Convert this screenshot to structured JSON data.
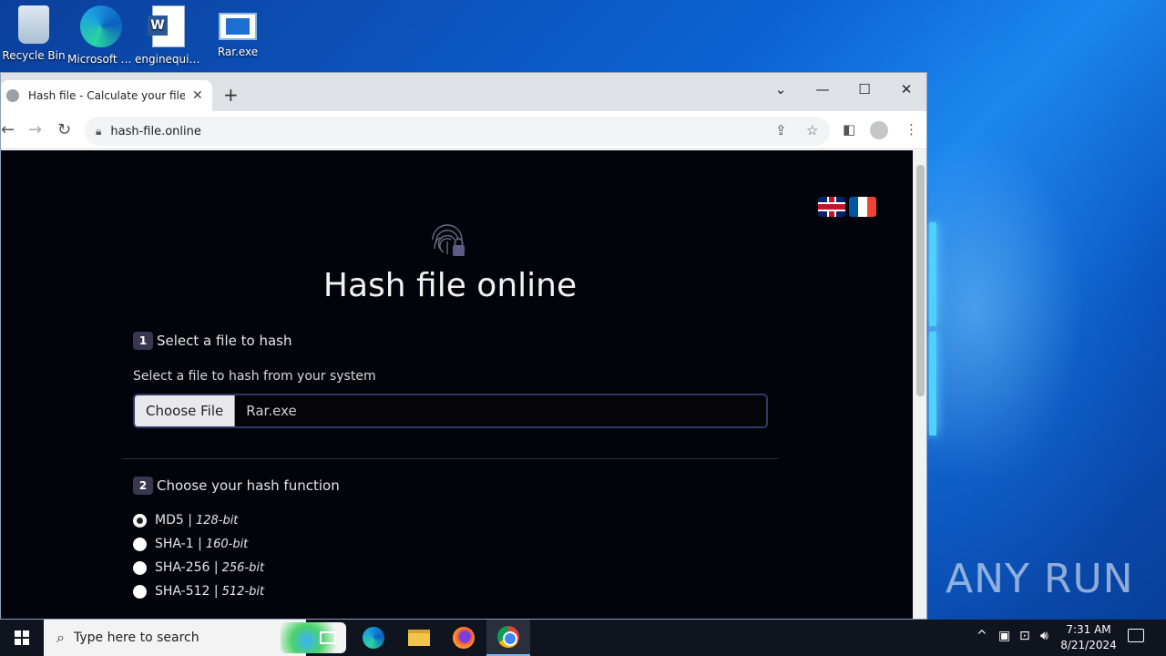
{
  "desktop": {
    "icons": [
      {
        "label": "Recycle Bin",
        "icon": "recycle-bin-icon"
      },
      {
        "label": "Microsoft Edge",
        "icon": "edge-icon"
      },
      {
        "label": "enginequit...",
        "icon": "word-doc-icon"
      },
      {
        "label": "Rar.exe",
        "icon": "rar-exe-icon"
      }
    ],
    "watermark": "ANY RUN"
  },
  "browser": {
    "tab_title": "Hash file - Calculate your file co",
    "url": "hash-file.online"
  },
  "page": {
    "title": "Hash file online",
    "step1": {
      "num": "1",
      "label": "Select a file to hash"
    },
    "file_label": "Select a file to hash from your system",
    "file_button": "Choose File",
    "file_name": "Rar.exe",
    "step2": {
      "num": "2",
      "label": "Choose your hash function"
    },
    "hash_options": [
      {
        "name": "MD5 |",
        "bits": "128-bit",
        "selected": true
      },
      {
        "name": "SHA-1 |",
        "bits": "160-bit",
        "selected": false
      },
      {
        "name": "SHA-256 |",
        "bits": "256-bit",
        "selected": false
      },
      {
        "name": "SHA-512 |",
        "bits": "512-bit",
        "selected": false
      }
    ]
  },
  "taskbar": {
    "search_placeholder": "Type here to search",
    "time": "7:31 AM",
    "date": "8/21/2024"
  },
  "colors": {
    "page_bg": "#03030b",
    "accent": "#3a3550",
    "taskbar": "#10141f"
  }
}
